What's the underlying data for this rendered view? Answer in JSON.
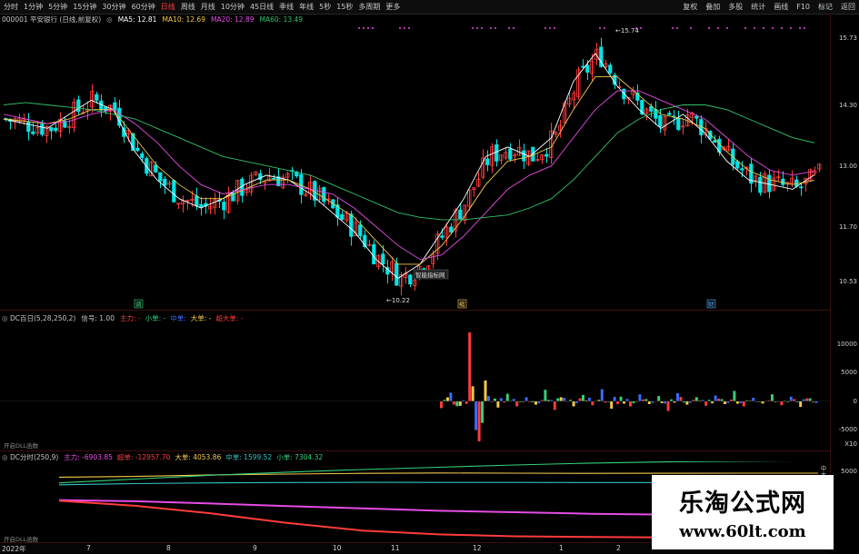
{
  "toolbar": {
    "periods": [
      "分时",
      "1分钟",
      "5分钟",
      "15分钟",
      "30分钟",
      "60分钟",
      "日线",
      "周线",
      "月线",
      "10分钟",
      "45日线",
      "季线",
      "年线",
      "5秒",
      "15秒",
      "多周期",
      "更多"
    ],
    "active_period": "日线",
    "right_tools": [
      "复权",
      "叠加",
      "多股",
      "统计",
      "画线",
      "F10",
      "标记",
      "返回"
    ]
  },
  "main_info": {
    "code_name": "000001 平安银行 (日线,前复权)",
    "ma5": "MA5: 12.81",
    "ma10": "MA10: 12.69",
    "ma20": "MA20: 12.89",
    "ma60": "MA60: 13.49"
  },
  "main_price_axis": [
    "15.73",
    "14.30",
    "13.00",
    "11.70",
    "10.53"
  ],
  "annotations": {
    "high_label": "15.74",
    "low_label": "10.22",
    "tooltip": "智能指标网",
    "marker_a": "调",
    "marker_b": "缩",
    "marker_c": "财"
  },
  "ind1": {
    "title": "DC百日(5,28,250,2)",
    "signal": "信号: 1.00",
    "legend": [
      {
        "text": "主力: -",
        "color": "#ff3b3b"
      },
      {
        "text": "小单: -",
        "color": "#33d17a"
      },
      {
        "text": "中单:",
        "color": "#3b6bff"
      },
      {
        "text": "大单: -",
        "color": "#f2c94c"
      },
      {
        "text": "超大单: -",
        "color": "#ff3b3b"
      }
    ],
    "axis": [
      "10000",
      "5000",
      "0",
      "-5000"
    ],
    "unit": "X10",
    "hint": "开启DLL函数"
  },
  "ind2": {
    "title": "DC分时(250,9)",
    "legend": [
      {
        "text": "主力: -6903.85",
        "color": "#e54ce5"
      },
      {
        "text": "超单: -12957.70",
        "color": "#ff3b3b"
      },
      {
        "text": "大单: 4053.86",
        "color": "#f2c94c"
      },
      {
        "text": "中单: 1599.52",
        "color": "#33c2c2"
      },
      {
        "text": "小单: 7304.32",
        "color": "#33d17a"
      }
    ],
    "axis": [
      "5000"
    ],
    "hint": "开启DLL函数",
    "end_tags": [
      "中",
      "大"
    ]
  },
  "x_axis": [
    "2022年",
    "7",
    "8",
    "9",
    "10",
    "11",
    "12",
    "1",
    "2"
  ],
  "watermark": {
    "line1": "乐淘公式网",
    "line2": "www.60lt.com"
  },
  "colors": {
    "up": "#ff3b3b",
    "down": "#00e5e5",
    "ma5": "#ffffff",
    "ma10": "#f2c94c",
    "ma20": "#e54ce5",
    "ma60": "#33c26a"
  },
  "chart_data": [
    {
      "type": "candlestick",
      "title": "000001 平安银行 (日线,前复权)",
      "ylim": [
        10.2,
        15.9
      ],
      "y_ticks": [
        15.73,
        14.3,
        13.0,
        11.7,
        10.53
      ],
      "x_ticks": [
        "2022年",
        "7",
        "8",
        "9",
        "10",
        "11",
        "12",
        "1",
        "2"
      ],
      "series": [
        {
          "name": "MA5",
          "values": [
            14.0,
            13.9,
            13.8,
            14.1,
            14.4,
            14.2,
            13.3,
            12.7,
            12.3,
            12.1,
            12.3,
            12.6,
            12.8,
            12.7,
            12.4,
            12.0,
            11.6,
            11.0,
            10.6,
            10.9,
            11.6,
            12.3,
            13.2,
            13.4,
            13.2,
            13.6,
            14.8,
            15.4,
            14.7,
            14.2,
            13.8,
            14.1,
            13.7,
            13.1,
            12.7,
            12.6,
            12.5,
            12.81
          ]
        },
        {
          "name": "MA10",
          "values": [
            14.0,
            13.95,
            13.9,
            14.0,
            14.2,
            14.2,
            13.6,
            13.0,
            12.6,
            12.3,
            12.3,
            12.5,
            12.7,
            12.7,
            12.5,
            12.2,
            11.9,
            11.4,
            10.9,
            10.9,
            11.3,
            11.9,
            12.6,
            13.1,
            13.2,
            13.4,
            14.2,
            14.9,
            14.9,
            14.5,
            14.1,
            14.0,
            13.8,
            13.3,
            12.9,
            12.7,
            12.6,
            12.69
          ]
        },
        {
          "name": "MA20",
          "values": [
            14.1,
            14.0,
            13.9,
            13.95,
            14.1,
            14.2,
            13.9,
            13.5,
            13.0,
            12.6,
            12.4,
            12.5,
            12.6,
            12.6,
            12.5,
            12.4,
            12.1,
            11.7,
            11.3,
            11.0,
            11.1,
            11.5,
            12.0,
            12.5,
            12.8,
            13.0,
            13.6,
            14.2,
            14.6,
            14.6,
            14.4,
            14.2,
            14.0,
            13.6,
            13.2,
            12.9,
            12.8,
            12.89
          ]
        },
        {
          "name": "MA60",
          "values": [
            14.3,
            14.35,
            14.3,
            14.25,
            14.2,
            14.1,
            14.0,
            13.8,
            13.6,
            13.4,
            13.2,
            13.1,
            13.0,
            12.9,
            12.8,
            12.6,
            12.4,
            12.2,
            12.0,
            11.9,
            11.85,
            11.85,
            11.9,
            11.95,
            12.1,
            12.3,
            12.7,
            13.2,
            13.7,
            14.0,
            14.2,
            14.3,
            14.3,
            14.2,
            14.0,
            13.8,
            13.6,
            13.49
          ]
        }
      ]
    },
    {
      "type": "bar",
      "title": "DC百日(5,28,250,2)",
      "ylim": [
        -7000,
        12000
      ],
      "y_ticks": [
        10000,
        5000,
        0,
        -5000
      ],
      "series": [
        {
          "name": "主力",
          "values": [
            -1200,
            1500,
            -800,
            12000,
            -7000,
            900,
            -1100,
            1300,
            -900,
            700,
            -600,
            2000,
            -1500,
            600,
            -900,
            1100,
            -700,
            2100,
            -1300,
            800,
            -900,
            1200,
            -500,
            900,
            -1700,
            1400,
            -600,
            700,
            -800,
            1000,
            -500,
            1800,
            -900,
            600,
            -400,
            1200,
            -700,
            800,
            -1000,
            500
          ]
        }
      ]
    },
    {
      "type": "line",
      "title": "DC分时(250,9)",
      "y_ticks": [
        5000
      ],
      "series": [
        {
          "name": "主力",
          "values": [
            -3000,
            -3300,
            -3900,
            -4600,
            -5200,
            -5800,
            -6200,
            -6600,
            -6800,
            -6850,
            -6903.85
          ]
        },
        {
          "name": "超单",
          "values": [
            -3200,
            -4500,
            -6500,
            -9000,
            -11000,
            -12000,
            -12500,
            -12700,
            -12800,
            -12900,
            -12957.7
          ]
        },
        {
          "name": "大单",
          "values": [
            3000,
            3200,
            3600,
            3800,
            4000,
            4100,
            4050,
            4000,
            4030,
            4050,
            4053.86
          ]
        },
        {
          "name": "中单",
          "values": [
            1000,
            1300,
            1500,
            1600,
            1650,
            1620,
            1610,
            1600,
            1600,
            1599,
            1599.52
          ]
        },
        {
          "name": "小单",
          "values": [
            1500,
            2500,
            3500,
            4300,
            5000,
            5600,
            6200,
            6700,
            7000,
            7200,
            7304.32
          ]
        }
      ]
    }
  ]
}
